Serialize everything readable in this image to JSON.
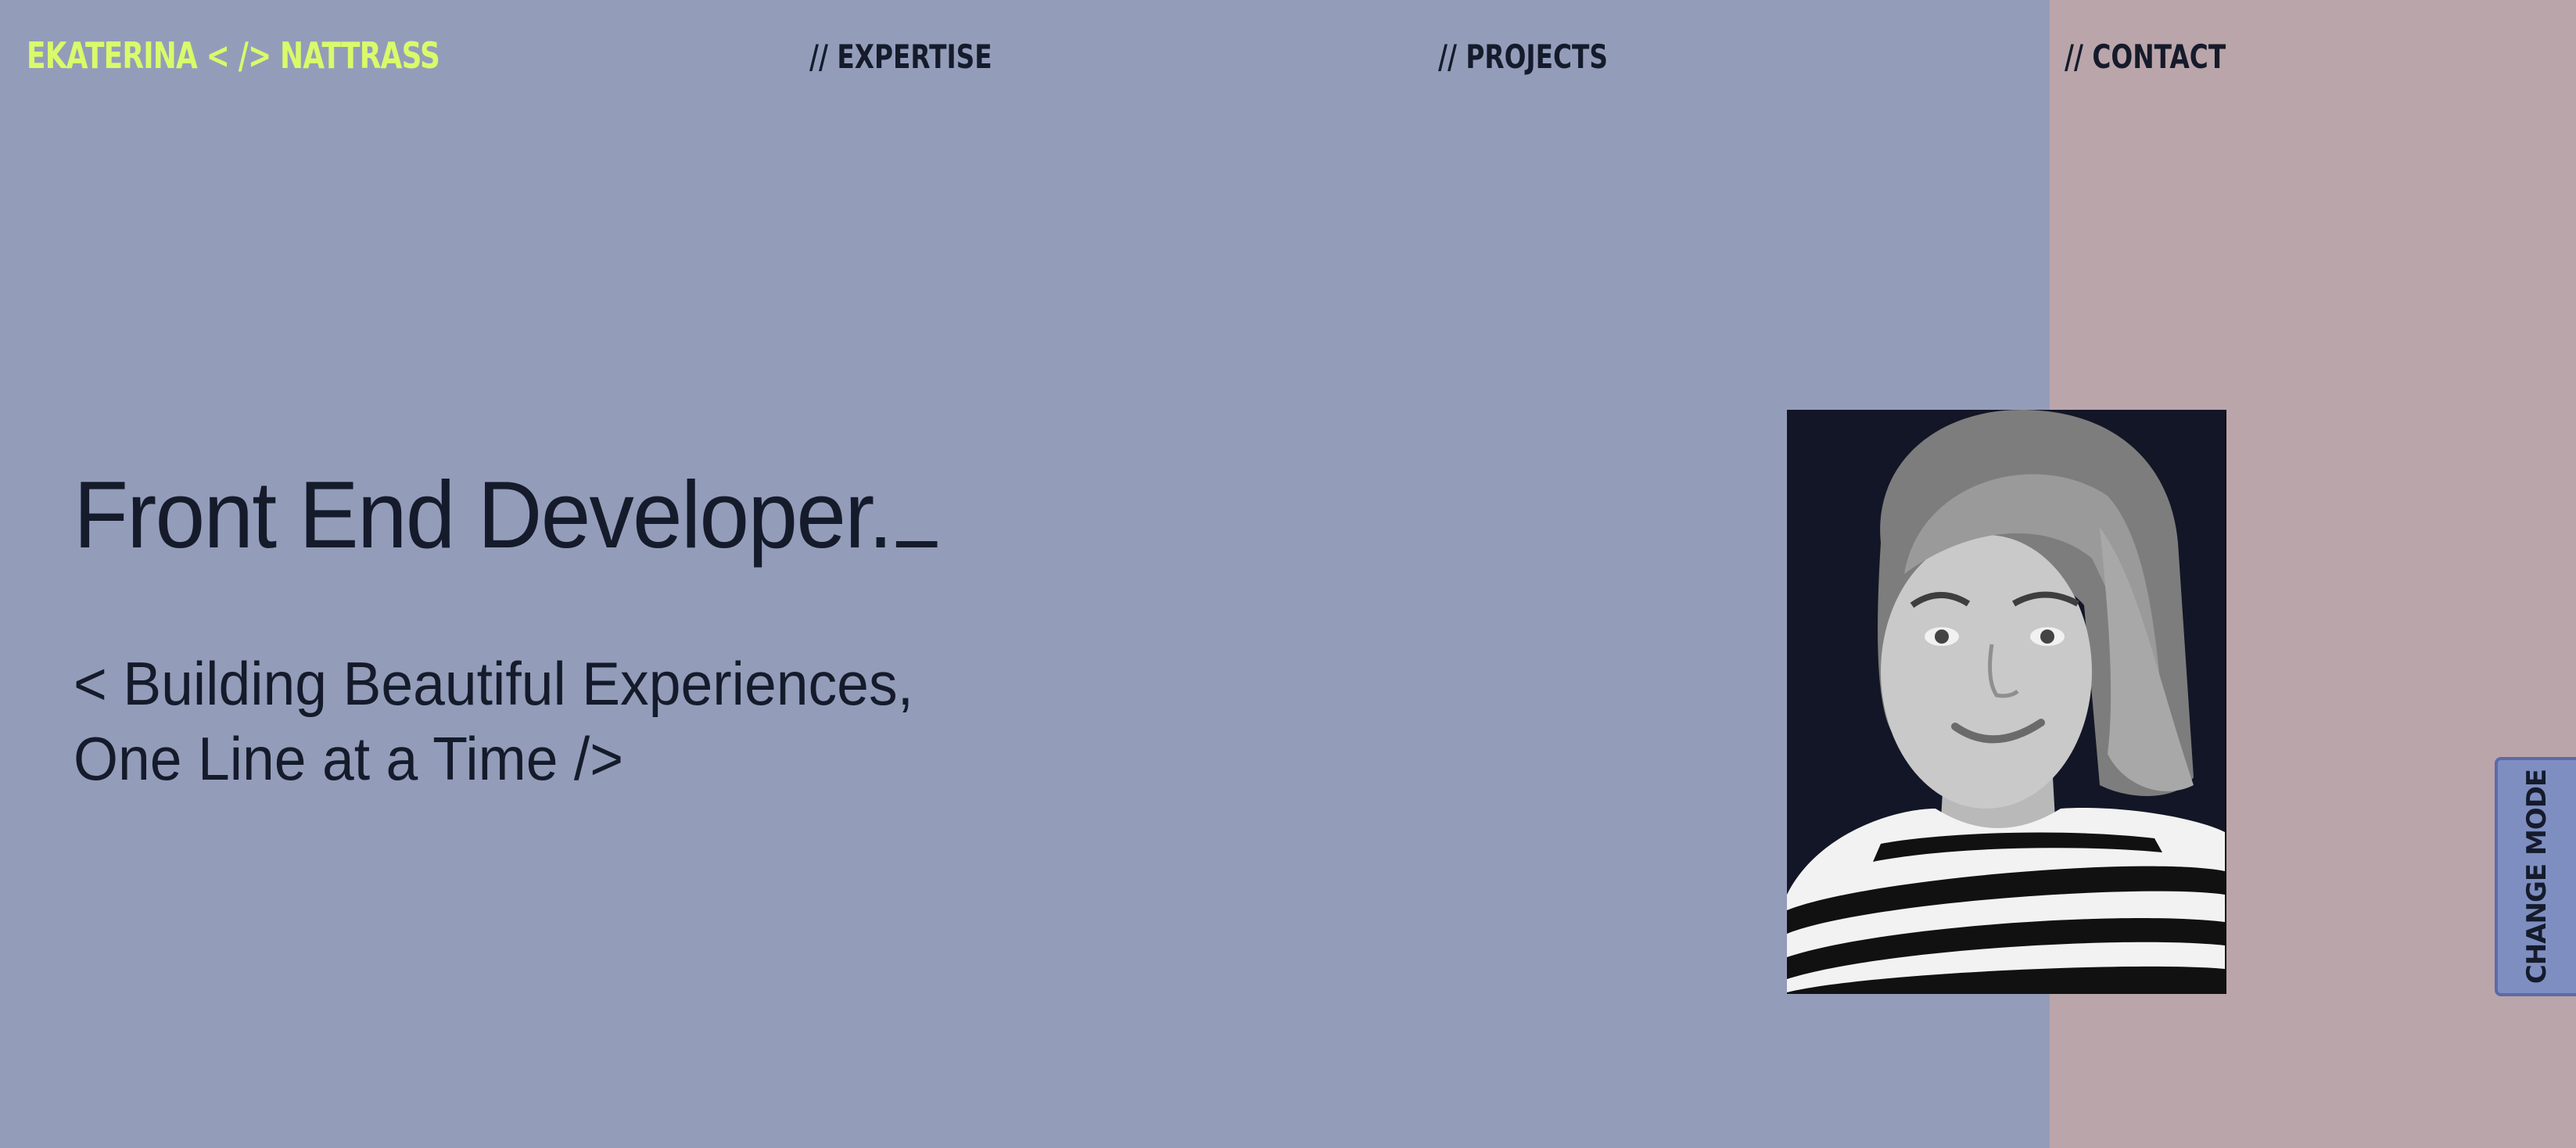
{
  "header": {
    "logo_text": "EKATERINA < /> NATTRASS",
    "nav": [
      {
        "label": "// EXPERTISE"
      },
      {
        "label": "// PROJECTS"
      },
      {
        "label": "// CONTACT"
      }
    ]
  },
  "hero": {
    "title": "Front End Developer.",
    "subtitle_line1": "< Building Beautiful Experiences,",
    "subtitle_line2": "One Line at a Time />",
    "photo_alt": "Portrait of Ekaterina Nattrass"
  },
  "controls": {
    "change_mode_label": "CHANGE MODE"
  },
  "colors": {
    "accent": "#d9fa6a",
    "background_left": "#939dba",
    "background_right": "#baa5aa",
    "text": "#151b2b",
    "button": "#7f8ec1"
  }
}
